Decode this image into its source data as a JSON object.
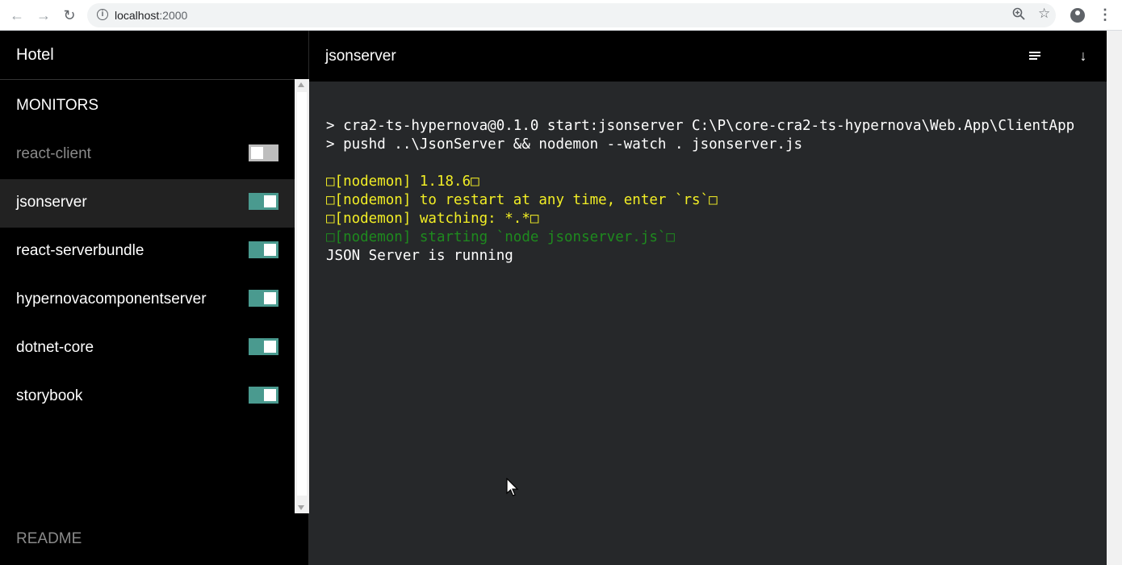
{
  "browser": {
    "url_host": "localhost",
    "url_port": ":2000",
    "icons": [
      "back-icon",
      "forward-icon",
      "reload-icon",
      "info-icon",
      "zoom-icon",
      "star-icon",
      "account-icon",
      "menu-icon"
    ]
  },
  "sidebar": {
    "app_title": "Hotel",
    "section_title": "MONITORS",
    "monitors": [
      {
        "name": "react-client",
        "running": false,
        "selected": false
      },
      {
        "name": "jsonserver",
        "running": true,
        "selected": true
      },
      {
        "name": "react-serverbundle",
        "running": true,
        "selected": false
      },
      {
        "name": "hypernovacomponentserver",
        "running": true,
        "selected": false
      },
      {
        "name": "dotnet-core",
        "running": true,
        "selected": false
      },
      {
        "name": "storybook",
        "running": true,
        "selected": false
      }
    ],
    "readme_label": "README"
  },
  "main": {
    "title": "jsonserver",
    "terminal": [
      {
        "text": "> cra2-ts-hypernova@0.1.0 start:jsonserver C:\\P\\core-cra2-ts-hypernova\\Web.App\\ClientApp",
        "color": "white"
      },
      {
        "text": "> pushd ..\\JsonServer && nodemon --watch . jsonserver.js",
        "color": "white"
      },
      {
        "text": "",
        "color": "white"
      },
      {
        "text": "□[nodemon] 1.18.6□",
        "color": "yellow"
      },
      {
        "text": "□[nodemon] to restart at any time, enter `rs`□",
        "color": "yellow"
      },
      {
        "text": "□[nodemon] watching: *.*□",
        "color": "yellow"
      },
      {
        "text": "□[nodemon] starting `node jsonserver.js`□",
        "color": "green"
      },
      {
        "text": "JSON Server is running",
        "color": "white"
      }
    ]
  },
  "colors": {
    "toggle_on": "#4a9a8f",
    "toggle_off": "#bdbdbd",
    "terminal_bg": "#26282a",
    "terminal_yellow": "#f2ee25",
    "terminal_green": "#1e8a1e"
  }
}
